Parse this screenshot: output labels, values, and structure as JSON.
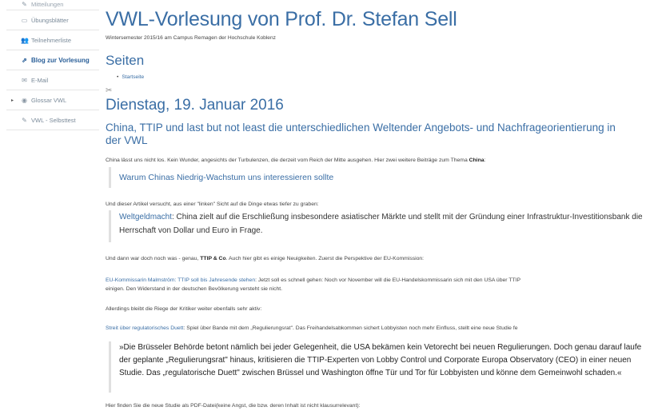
{
  "sidebar": {
    "items": [
      {
        "label": "Mitteilungen",
        "icon": "megaphone-icon",
        "glyph": "✎"
      },
      {
        "label": "Übungsblätter",
        "icon": "folder-icon",
        "glyph": "▭"
      },
      {
        "label": "Teilnehmerliste",
        "icon": "users-icon",
        "glyph": "👥"
      },
      {
        "label": "Blog zur Vorlesung",
        "icon": "external-link-icon",
        "glyph": "⇗"
      },
      {
        "label": "E-Mail",
        "icon": "envelope-icon",
        "glyph": "✉"
      },
      {
        "label": "Glossar VWL",
        "icon": "globe-icon",
        "glyph": "◉"
      },
      {
        "label": "VWL - Selbsttest",
        "icon": "edit-icon",
        "glyph": "✎"
      }
    ]
  },
  "blog": {
    "title": "VWL-Vorlesung von Prof. Dr. Stefan Sell",
    "description": "Wintersemester 2015/16 am Campus Remagen der Hochschule Koblenz"
  },
  "pages": {
    "title": "Seiten",
    "items": [
      "Startseite"
    ]
  },
  "post": {
    "date": "Dienstag, 19. Januar 2016",
    "title": "China, TTIP und last but not least die unterschiedlichen Weltender Angebots- und Nachfrageorientierung in der VWL",
    "p1_text": "China lässt uns nicht los. Kein Wunder, angesichts der Turbulenzen, die derzeit vom Reich der Mitte ausgehen. Hier zwei weitere Beiträge zum Thema ",
    "p1_bold": "China",
    "p1_end": ":",
    "quote1_link": "Warum Chinas Niedrig-Wachstum uns interessieren sollte",
    "p2": "Und dieser Artikel versucht, aus einer \"linken\" Sicht auf die Dinge etwas tiefer zu graben:",
    "quote2_link": "Weltgeldmacht",
    "quote2_text": ": China zielt auf die Erschließung insbesondere asiatischer Märkte und stellt mit der Gründung einer Infrastruktur-Investitionsbank die Herrschaft von Dollar und Euro in Frage.",
    "p3_text": "Und dann war doch noch was - genau, ",
    "p3_bold": "TTIP & Co",
    "p3_end": ". Auch hier gibt es einige Neuigkeiten. Zuerst die Perspektive der EU-Kommission:",
    "p4_link": "EU-Kommissarin Malmström: TTIP soll bis Jahresende stehen",
    "p4_text": ": Jetzt soll es schnell gehen: Noch vor November will die EU-Handelskommissarin sich mit den USA über TTIP",
    "p4_line2": "einigen. Den Widerstand in der deutschen Bevölkerung versteht sie nicht.",
    "p5": "Allerdings bleibt die Riege der Kritiker weiter ebenfalls sehr aktiv:",
    "p6_link": "Streit über regulatorisches Duett",
    "p6_text": ": Spiel über Bande mit dem „Regulierungsrat\". Das Freihandelsabkommen sichert Lobbyisten noch mehr Einfluss, stellt eine neue Studie fe",
    "quote3": "»Die Brüsseler Behörde betont nämlich bei jeder Gelegenheit, die USA bekämen kein Vetorecht bei neuen Regulierungen. Doch genau darauf laufe der geplante „Regulierungsrat\" hinaus, kritisieren die TTIP-Experten von Lobby Control und Corporate Europa Observatory (CEO) in einer neuen Studie. Das „regulatorische Duett\" zwischen Brüssel und Washington öffne Tür und Tor für Lobbyisten und könne dem Gemeinwohl schaden.«",
    "p7": "Hier finden Sie die neue Studie als PDF-Datei(keine Angst, die bzw. deren Inhalt ist nicht klausurrelevant):"
  },
  "colors": {
    "link": "#3a6ea5",
    "active_sidebar": "#2a5f98",
    "text": "#444444"
  }
}
